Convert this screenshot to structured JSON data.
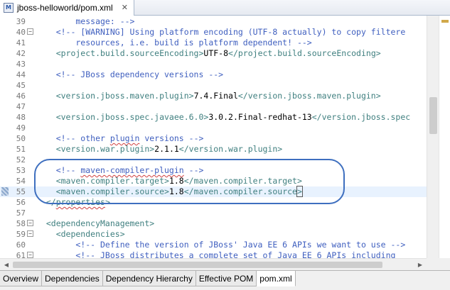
{
  "editor_tab": {
    "icon": "maven-pom-file-icon",
    "icon_letter": "M",
    "title": "jboss-helloworld/pom.xml",
    "close_glyph": "✕"
  },
  "lines": [
    {
      "n": "39",
      "parts": [
        {
          "c": "cmt",
          "t": "        message: -->"
        }
      ]
    },
    {
      "n": "40",
      "fold": "−",
      "parts": [
        {
          "c": "cmt",
          "t": "    <!-- [WARNING] Using platform encoding (UTF-8 actually) to copy filtere"
        }
      ]
    },
    {
      "n": "41",
      "parts": [
        {
          "c": "cmt",
          "t": "        resources, i.e. build is platform dependent! -->"
        }
      ]
    },
    {
      "n": "42",
      "parts": [
        {
          "c": "tag",
          "t": "    <project.build.sourceEncoding>"
        },
        {
          "c": "txt",
          "t": "UTF-8"
        },
        {
          "c": "tag",
          "t": "</project.build.sourceEncoding>"
        }
      ]
    },
    {
      "n": "43",
      "parts": []
    },
    {
      "n": "44",
      "parts": [
        {
          "c": "cmt",
          "t": "    <!-- JBoss dependency versions -->"
        }
      ]
    },
    {
      "n": "45",
      "parts": []
    },
    {
      "n": "46",
      "parts": [
        {
          "c": "tag",
          "t": "    <version.jboss.maven.plugin>"
        },
        {
          "c": "txt",
          "t": "7.4.Final"
        },
        {
          "c": "tag",
          "t": "</version.jboss.maven.plugin>"
        }
      ]
    },
    {
      "n": "47",
      "parts": []
    },
    {
      "n": "48",
      "parts": [
        {
          "c": "tag",
          "t": "    <version.jboss.spec.javaee.6.0>"
        },
        {
          "c": "txt",
          "t": "3.0.2.Final-redhat-13"
        },
        {
          "c": "tag",
          "t": "</version.jboss.spec"
        }
      ]
    },
    {
      "n": "49",
      "parts": []
    },
    {
      "n": "50",
      "parts": [
        {
          "c": "cmt",
          "t": "    <!-- other "
        },
        {
          "c": "cmt squig",
          "t": "plugin"
        },
        {
          "c": "cmt",
          "t": " versions -->"
        }
      ]
    },
    {
      "n": "51",
      "parts": [
        {
          "c": "tag",
          "t": "    <version.war.plugin>"
        },
        {
          "c": "txt",
          "t": "2.1.1"
        },
        {
          "c": "tag",
          "t": "</version.war.plugin>"
        }
      ]
    },
    {
      "n": "52",
      "parts": []
    },
    {
      "n": "53",
      "parts": [
        {
          "c": "cmt",
          "t": "    <!-- "
        },
        {
          "c": "cmt squig",
          "t": "maven-compiler-plugin"
        },
        {
          "c": "cmt",
          "t": " -->"
        }
      ]
    },
    {
      "n": "54",
      "parts": [
        {
          "c": "tag",
          "t": "    <maven.compiler.target>"
        },
        {
          "c": "txt",
          "t": "1.8"
        },
        {
          "c": "tag",
          "t": "</maven.compiler.target>"
        }
      ]
    },
    {
      "n": "55",
      "current": true,
      "marker": true,
      "parts": [
        {
          "c": "tag",
          "t": "    <maven.compiler.source>"
        },
        {
          "c": "txt",
          "t": "1.8"
        },
        {
          "c": "tag",
          "t": "</maven.compiler.source"
        },
        {
          "c": "tag caret-box",
          "t": ">"
        }
      ]
    },
    {
      "n": "56",
      "parts": [
        {
          "c": "tag",
          "t": "  </"
        },
        {
          "c": "tag squig",
          "t": "properties"
        },
        {
          "c": "tag",
          "t": ">"
        }
      ]
    },
    {
      "n": "57",
      "parts": []
    },
    {
      "n": "58",
      "fold": "−",
      "parts": [
        {
          "c": "tag",
          "t": "  <dependencyManagement>"
        }
      ]
    },
    {
      "n": "59",
      "fold": "−",
      "parts": [
        {
          "c": "tag",
          "t": "    <dependencies>"
        }
      ]
    },
    {
      "n": "60",
      "parts": [
        {
          "c": "cmt",
          "t": "        <!-- Define the version of JBoss' Java EE 6 APIs we want to use -->"
        }
      ]
    },
    {
      "n": "61",
      "fold": "−",
      "parts": [
        {
          "c": "cmt",
          "t": "        <!-- JBoss distributes a complete set of Java EE 6 APIs including"
        }
      ]
    }
  ],
  "scroll": {
    "left_arrow": "◀",
    "right_arrow": "▶"
  },
  "page_tabs": [
    {
      "id": "overview",
      "label": "Overview"
    },
    {
      "id": "dependencies",
      "label": "Dependencies"
    },
    {
      "id": "dependency-hierarchy",
      "label": "Dependency Hierarchy"
    },
    {
      "id": "effective-pom",
      "label": "Effective POM"
    },
    {
      "id": "pom-xml",
      "label": "pom.xml",
      "active": true
    }
  ],
  "colors": {
    "tag": "#3f7f7f",
    "comment": "#3f5fbf",
    "text": "#000000",
    "annotation": "#3e6fbf",
    "current_line": "#e8f2fe"
  }
}
